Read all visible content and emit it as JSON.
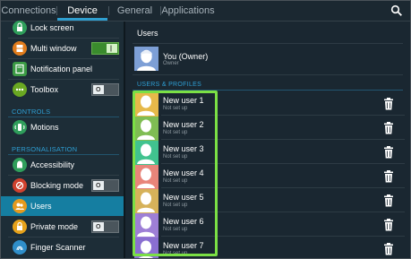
{
  "tabs": [
    {
      "label": "Connections",
      "active": false
    },
    {
      "label": "Device",
      "active": true
    },
    {
      "label": "General",
      "active": false
    },
    {
      "label": "Applications",
      "active": false
    }
  ],
  "search_icon": "search-icon",
  "sidebar": {
    "items": [
      {
        "label": "Lock screen",
        "icon": "lock-screen-icon",
        "color": "#2f9e5b"
      },
      {
        "label": "Multi window",
        "icon": "multi-window-icon",
        "color": "#e17c1c",
        "toggle": "on"
      },
      {
        "label": "Notification panel",
        "icon": "notification-panel-icon",
        "color": "#3b9a44"
      },
      {
        "label": "Toolbox",
        "icon": "toolbox-icon",
        "color": "#6aa822",
        "toggle": "off"
      }
    ],
    "controls_header": "CONTROLS",
    "controls_items": [
      {
        "label": "Motions",
        "icon": "motions-icon",
        "color": "#2f9e5b"
      }
    ],
    "personalisation_header": "PERSONALISATION",
    "personalisation_items": [
      {
        "label": "Accessibility",
        "icon": "accessibility-icon",
        "color": "#2f9e5b"
      },
      {
        "label": "Blocking mode",
        "icon": "blocking-mode-icon",
        "color": "#d0412e",
        "toggle": "off"
      },
      {
        "label": "Users",
        "icon": "users-icon",
        "color": "#e59a1e",
        "selected": true
      },
      {
        "label": "Private mode",
        "icon": "private-mode-icon",
        "color": "#e6a21b",
        "toggle": "off"
      },
      {
        "label": "Finger Scanner",
        "icon": "finger-scanner-icon",
        "color": "#2f8ec9"
      }
    ]
  },
  "main": {
    "title": "Users",
    "owner": {
      "name": "You (Owner)",
      "subtitle": "Owner",
      "avatar_bg": "#7d9fd6"
    },
    "section_header": "USERS & PROFILES",
    "users": [
      {
        "name": "New user 1",
        "status": "Not set up",
        "avatar_bg": "#e6b94a"
      },
      {
        "name": "New user 2",
        "status": "Not set up",
        "avatar_bg": "#7fbd53"
      },
      {
        "name": "New user 3",
        "status": "Not set up",
        "avatar_bg": "#41c38f"
      },
      {
        "name": "New user 4",
        "status": "Not set up",
        "avatar_bg": "#e8857a"
      },
      {
        "name": "New user 5",
        "status": "Not set up",
        "avatar_bg": "#d6b25a"
      },
      {
        "name": "New user 6",
        "status": "Not set up",
        "avatar_bg": "#9e7fd6"
      },
      {
        "name": "New user 7",
        "status": "Not set up",
        "avatar_bg": "#8a6fd1"
      }
    ],
    "delete_icon": "trash-icon",
    "highlight_color": "#7be045"
  }
}
